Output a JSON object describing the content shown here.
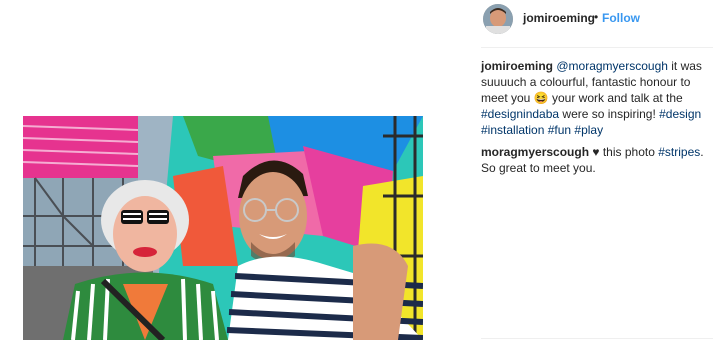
{
  "post": {
    "author": "jomiroeming",
    "separator": "•",
    "follow_label": "Follow"
  },
  "comments": [
    {
      "user": "jomiroeming",
      "parts": [
        {
          "type": "mention",
          "text": "@moragmyerscough"
        },
        {
          "type": "text",
          "text": " it was suuuuch a colourful, fantastic honour to meet you "
        },
        {
          "type": "emoji",
          "text": "😆"
        },
        {
          "type": "text",
          "text": " your work and talk at the "
        },
        {
          "type": "hashtag",
          "text": "#designindaba"
        },
        {
          "type": "text",
          "text": " were so inspiring! "
        },
        {
          "type": "hashtag",
          "text": "#design"
        },
        {
          "type": "text",
          "text": " "
        },
        {
          "type": "hashtag",
          "text": "#installation"
        },
        {
          "type": "text",
          "text": " "
        },
        {
          "type": "hashtag",
          "text": "#fun"
        },
        {
          "type": "text",
          "text": " "
        },
        {
          "type": "hashtag",
          "text": "#play"
        }
      ]
    },
    {
      "user": "moragmyerscough",
      "parts": [
        {
          "type": "emoji",
          "text": "♥"
        },
        {
          "type": "text",
          "text": " this photo "
        },
        {
          "type": "hashtag",
          "text": "#stripes"
        },
        {
          "type": "text",
          "text": ". So great to meet you."
        }
      ]
    }
  ],
  "colors": {
    "link": "#003569",
    "follow": "#3897f0",
    "text": "#262626"
  },
  "icons": {
    "avatar": "profile-photo",
    "heart": "heart-icon"
  }
}
